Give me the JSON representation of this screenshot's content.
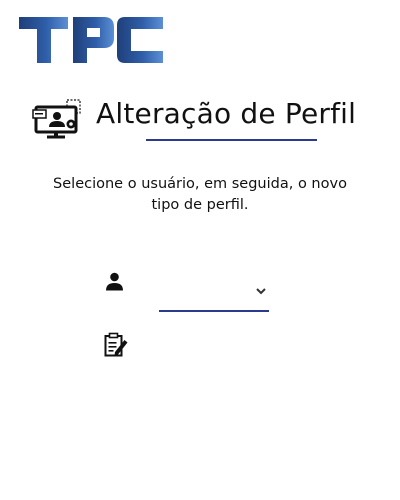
{
  "header": {
    "logo_text": "TPC",
    "logo_icon": "tpc-logo",
    "icon": "monitor-user-settings-icon",
    "title": "Alteração de Perfil"
  },
  "form": {
    "instructions": "Selecione o usuário, em seguida, o novo tipo de perfil.",
    "user_field_icon": "person-icon",
    "user_select_value": "",
    "profile_field_icon": "edit-document-icon"
  },
  "colors": {
    "logo_dark_blue": "#1f3f7a",
    "logo_light_blue": "#5b8fd6",
    "accent_underline": "#2a3a8f",
    "text": "#111111"
  }
}
